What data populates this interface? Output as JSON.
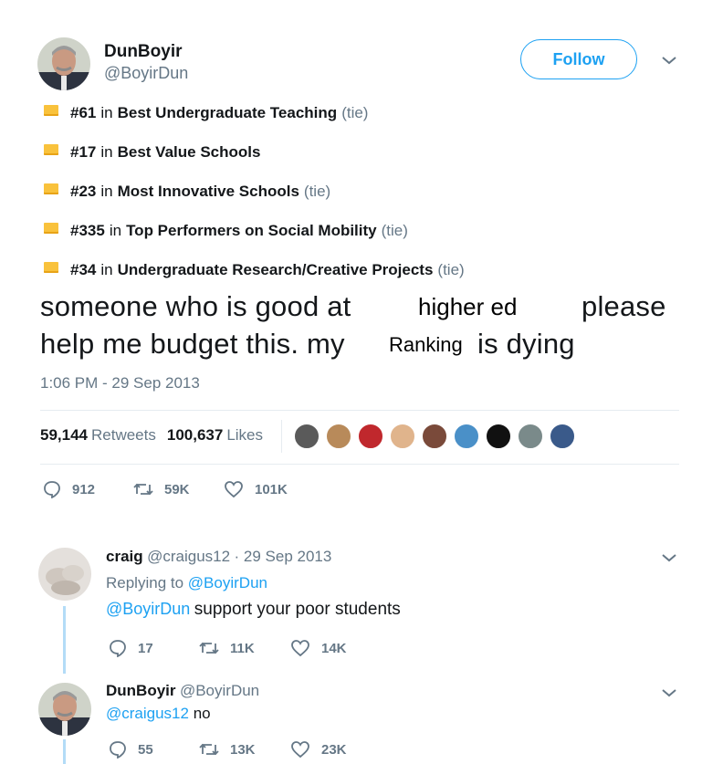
{
  "main_tweet": {
    "author": {
      "name": "DunBoyir",
      "handle": "@BoyirDun"
    },
    "follow_label": "Follow",
    "rankings": [
      {
        "number": "#61",
        "in": "in",
        "category": "Best Undergraduate Teaching",
        "tie": "(tie)"
      },
      {
        "number": "#17",
        "in": "in",
        "category": "Best Value Schools",
        "tie": ""
      },
      {
        "number": "#23",
        "in": "in",
        "category": "Most Innovative Schools",
        "tie": "(tie)"
      },
      {
        "number": "#335",
        "in": "in",
        "category": "Top Performers on Social Mobility",
        "tie": "(tie)"
      },
      {
        "number": "#34",
        "in": "in",
        "category": "Undergraduate Research/Creative Projects",
        "tie": "(tie)"
      }
    ],
    "text": {
      "line1_a": "someone who is good at",
      "insert1": "higher ed",
      "line1_b": "please",
      "line2_a": "help me budget this. my",
      "insert2": "Ranking",
      "line2_b": "is dying"
    },
    "timestamp": "1:06 PM - 29 Sep 2013",
    "retweets_count": "59,144",
    "retweets_label": "Retweets",
    "likes_count": "100,637",
    "likes_label": "Likes",
    "actions": {
      "replies": "912",
      "retweets": "59K",
      "likes": "101K"
    },
    "colors": {
      "accent": "#1da1f2",
      "muted": "#657786",
      "ranking_icon": "#f9c23c"
    }
  },
  "replies": [
    {
      "name": "craig",
      "handle": "@craigus12",
      "date": "· 29 Sep 2013",
      "replying_to_label": "Replying to",
      "replying_to_handle": "@BoyirDun",
      "mention": "@BoyirDun",
      "text": "support your poor students",
      "actions": {
        "replies": "17",
        "retweets": "11K",
        "likes": "14K"
      }
    },
    {
      "name": "DunBoyir",
      "handle": "@BoyirDun",
      "mention": "@craigus12",
      "text": "no",
      "actions": {
        "replies": "55",
        "retweets": "13K",
        "likes": "23K"
      }
    }
  ]
}
